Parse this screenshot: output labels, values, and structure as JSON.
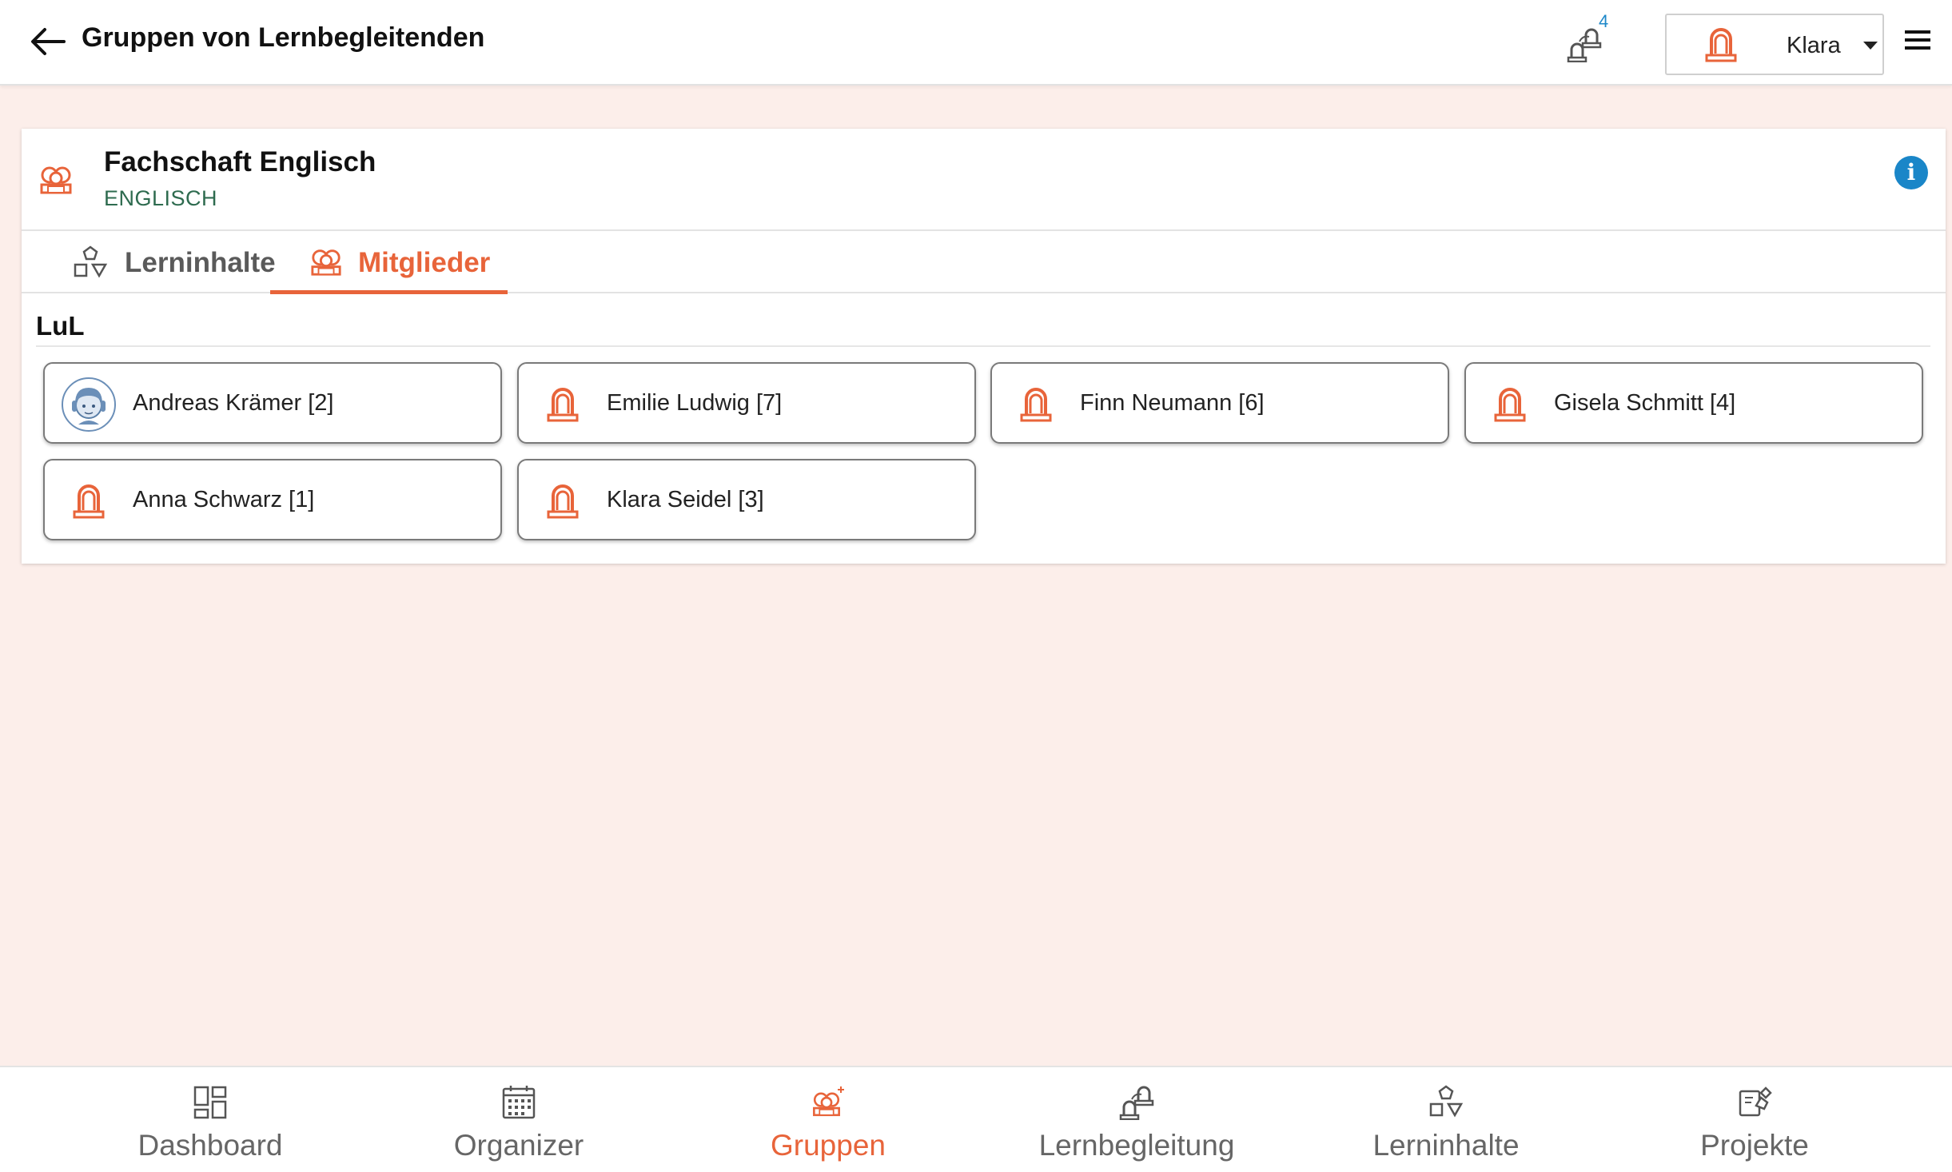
{
  "header": {
    "title": "Gruppen von Lernbegleitenden",
    "notification_count": "4",
    "user_name": "Klara"
  },
  "group": {
    "title": "Fachschaft Englisch",
    "subject": "ENGLISCH"
  },
  "tabs": [
    {
      "label": "Lerninhalte",
      "active": false
    },
    {
      "label": "Mitglieder",
      "active": true
    }
  ],
  "section": {
    "title": "LuL"
  },
  "members": [
    {
      "name": "Andreas Krämer [2]",
      "avatar": "custom-avatar"
    },
    {
      "name": "Emilie Ludwig [7]",
      "avatar": "default-user-icon"
    },
    {
      "name": "Finn Neumann [6]",
      "avatar": "default-user-icon"
    },
    {
      "name": "Gisela Schmitt [4]",
      "avatar": "default-user-icon"
    },
    {
      "name": "Anna Schwarz [1]",
      "avatar": "default-user-icon"
    },
    {
      "name": "Klara Seidel [3]",
      "avatar": "default-user-icon"
    }
  ],
  "bottom_nav": [
    {
      "label": "Dashboard",
      "icon": "dashboard-icon",
      "active": false
    },
    {
      "label": "Organizer",
      "icon": "calendar-icon",
      "active": false
    },
    {
      "label": "Gruppen",
      "icon": "groups-icon",
      "active": true
    },
    {
      "label": "Lernbegleitung",
      "icon": "mentoring-icon",
      "active": false
    },
    {
      "label": "Lerninhalte",
      "icon": "shapes-icon",
      "active": false
    },
    {
      "label": "Projekte",
      "icon": "projects-icon",
      "active": false
    }
  ],
  "colors": {
    "accent": "#e8643a",
    "background": "#fceeea",
    "info": "#1a86c8",
    "subject_text": "#2e6b4f"
  }
}
